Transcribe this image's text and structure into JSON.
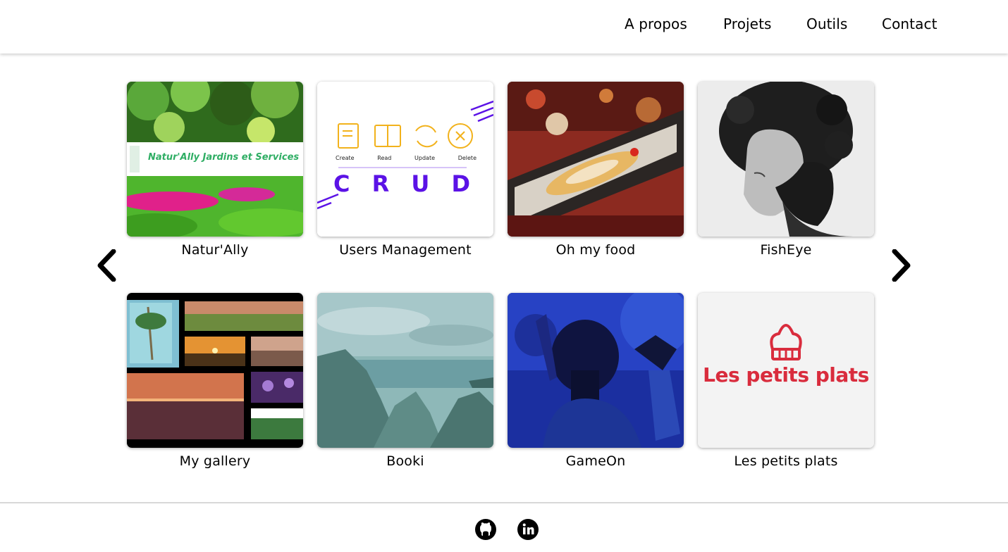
{
  "nav": {
    "items": [
      {
        "label": "A propos"
      },
      {
        "label": "Projets"
      },
      {
        "label": "Outils"
      },
      {
        "label": "Contact"
      }
    ]
  },
  "carousel": {
    "prev_icon": "chevron-left-icon",
    "next_icon": "chevron-right-icon",
    "projects": [
      {
        "title": "Natur'Ally",
        "image": {
          "banner_text": "Natur'Ally Jardins et Services"
        }
      },
      {
        "title": "Users Management",
        "image": {
          "actions": [
            "Create",
            "Read",
            "Update",
            "Delete"
          ],
          "big_text": "C R U D"
        }
      },
      {
        "title": "Oh my food"
      },
      {
        "title": "FishEye"
      },
      {
        "title": "My gallery"
      },
      {
        "title": "Booki"
      },
      {
        "title": "GameOn"
      },
      {
        "title": "Les petits plats",
        "image": {
          "logo_text": "Les petits plats"
        }
      }
    ]
  },
  "footer": {
    "links": [
      {
        "icon": "github-icon"
      },
      {
        "icon": "linkedin-icon"
      }
    ]
  },
  "colors": {
    "crud_purple": "#5b12e6",
    "crud_yellow": "#f2b21c",
    "naturally_green": "#2fae64",
    "petits_plats_red": "#d92c3d"
  }
}
